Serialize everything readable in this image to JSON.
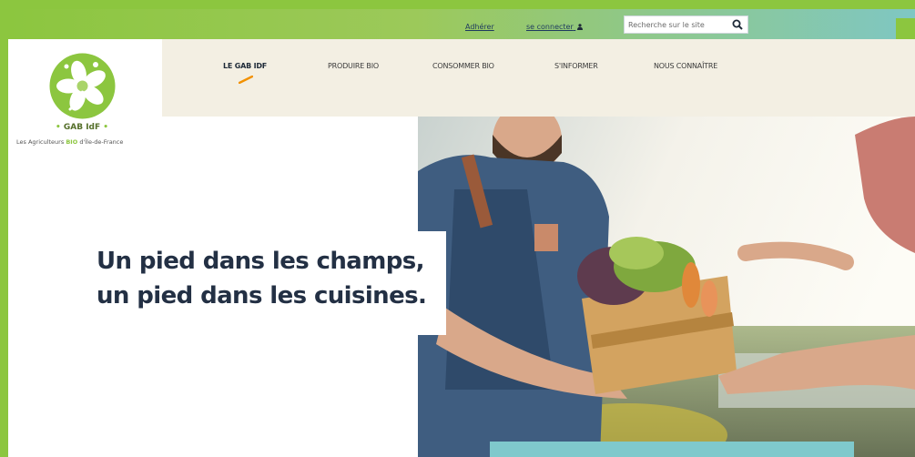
{
  "topbar": {
    "adherer": "Adhérer",
    "connect": "se connecter",
    "search_placeholder": "Recherche sur le site"
  },
  "nav": {
    "items": [
      {
        "label": "LE GAB IDF",
        "active": true
      },
      {
        "label": "PRODUIRE BIO"
      },
      {
        "label": "CONSOMMER BIO"
      },
      {
        "label": "S'INFORMER"
      },
      {
        "label": "NOUS CONNAÎTRE"
      }
    ]
  },
  "logo": {
    "name": "GAB IdF",
    "tag_prefix": "Les Agriculteurs",
    "tag_bio": "BIO",
    "tag_suffix": "d'Île-de-France"
  },
  "hero": {
    "line1": "Un pied dans les champs,",
    "line2": "un pied dans les cuisines."
  },
  "colors": {
    "green": "#8cc63f",
    "teal": "#7fc9cc",
    "navy": "#233044",
    "beige": "#f3efe3"
  },
  "icons": [
    "user-icon",
    "search-icon",
    "flower-logo-icon",
    "active-underline-icon"
  ]
}
